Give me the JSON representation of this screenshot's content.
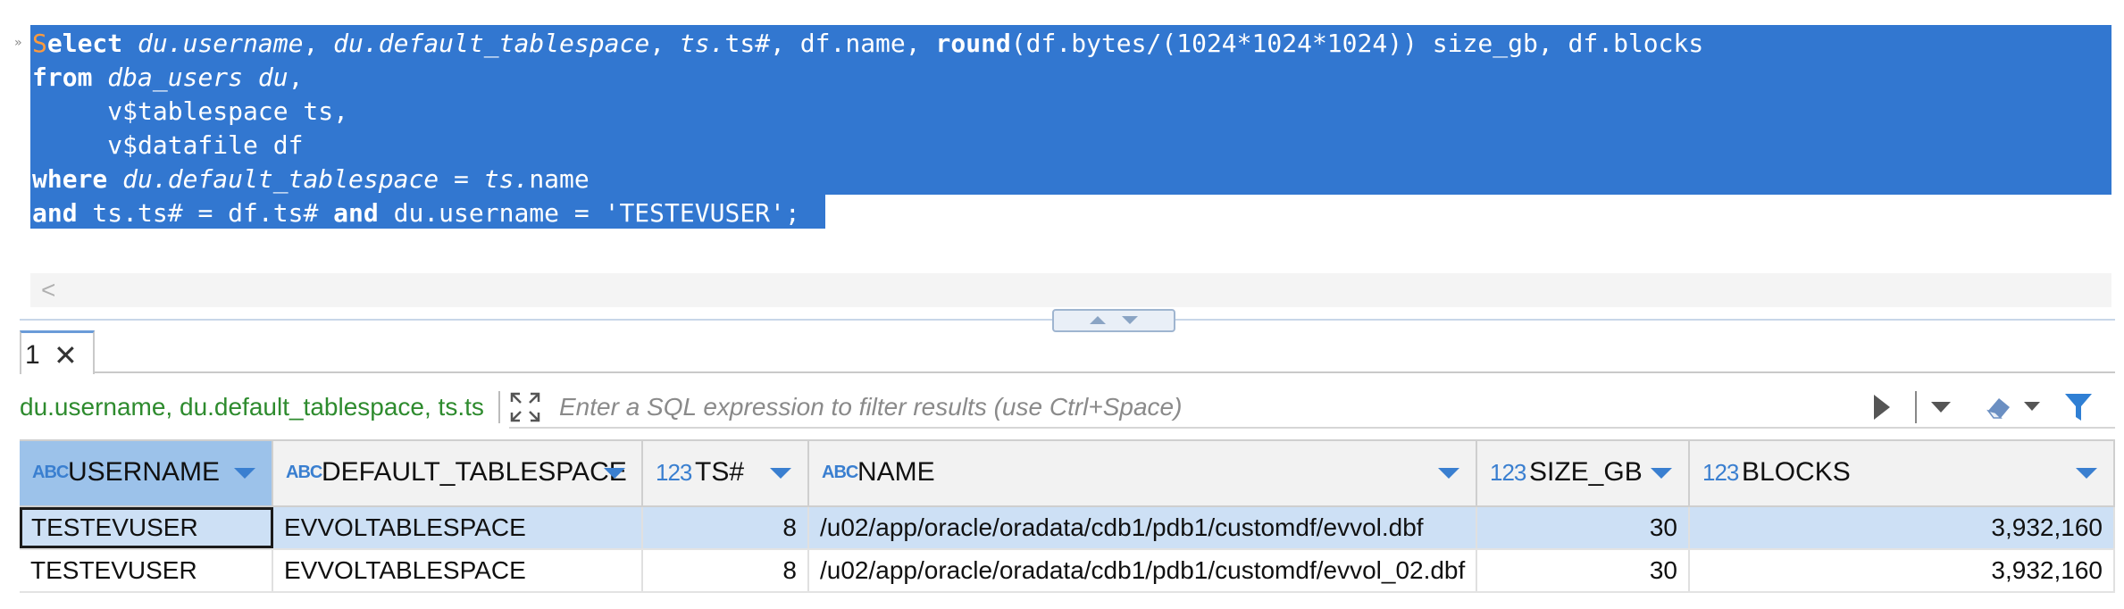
{
  "editor": {
    "lines": [
      {
        "parts": [
          {
            "t": "S",
            "c": "caret"
          },
          {
            "t": "elect",
            "c": "kw"
          },
          {
            "t": " "
          },
          {
            "t": "du.username",
            "c": "it"
          },
          {
            "t": ", "
          },
          {
            "t": "du.default_tablespace",
            "c": "it"
          },
          {
            "t": ", "
          },
          {
            "t": "ts.",
            "c": "it"
          },
          {
            "t": "ts#, df.name, "
          },
          {
            "t": "round",
            "c": "kw"
          },
          {
            "t": "(df.bytes/(1024*1024*1024)) size_gb, df.blocks"
          }
        ]
      },
      {
        "parts": [
          {
            "t": "from",
            "c": "kw"
          },
          {
            "t": " "
          },
          {
            "t": "dba_users du",
            "c": "it"
          },
          {
            "t": ","
          }
        ]
      },
      {
        "parts": [
          {
            "t": "     v$tablespace ts,"
          }
        ]
      },
      {
        "parts": [
          {
            "t": "     v$datafile df"
          }
        ]
      },
      {
        "parts": [
          {
            "t": "where",
            "c": "kw"
          },
          {
            "t": " "
          },
          {
            "t": "du.default_tablespace",
            "c": "it"
          },
          {
            "t": " = "
          },
          {
            "t": "ts.",
            "c": "it"
          },
          {
            "t": "name"
          }
        ]
      },
      {
        "parts": [
          {
            "t": "and",
            "c": "kw"
          },
          {
            "t": " ts.ts# = df.ts# "
          },
          {
            "t": "and",
            "c": "kw"
          },
          {
            "t": " du.username = 'TESTEVUSER';"
          }
        ]
      }
    ],
    "hscroll_arrow": "<"
  },
  "results": {
    "tab_label": "1",
    "tab_close": "✕",
    "filter_query": "du.username, du.default_tablespace, ts.ts",
    "filter_placeholder": "Enter a SQL expression to filter results (use Ctrl+Space)",
    "columns": [
      {
        "type": "ABC",
        "name": "USERNAME"
      },
      {
        "type": "ABC",
        "name": "DEFAULT_TABLESPACE"
      },
      {
        "type": "123",
        "name": "TS#"
      },
      {
        "type": "ABC",
        "name": "NAME"
      },
      {
        "type": "123",
        "name": "SIZE_GB"
      },
      {
        "type": "123",
        "name": "BLOCKS"
      }
    ],
    "rows": [
      [
        "TESTEVUSER",
        "EVVOLTABLESPACE",
        "8",
        "/u02/app/oracle/oradata/cdb1/pdb1/customdf/evvol.dbf",
        "30",
        "3,932,160"
      ],
      [
        "TESTEVUSER",
        "EVVOLTABLESPACE",
        "8",
        "/u02/app/oracle/oradata/cdb1/pdb1/customdf/evvol_02.dbf",
        "30",
        "3,932,160"
      ]
    ]
  },
  "colors": {
    "selection": "#3277d0",
    "filter_query": "#2e8b2e",
    "header_selected": "#9cc2ea",
    "row_selected": "#cde0f5"
  }
}
